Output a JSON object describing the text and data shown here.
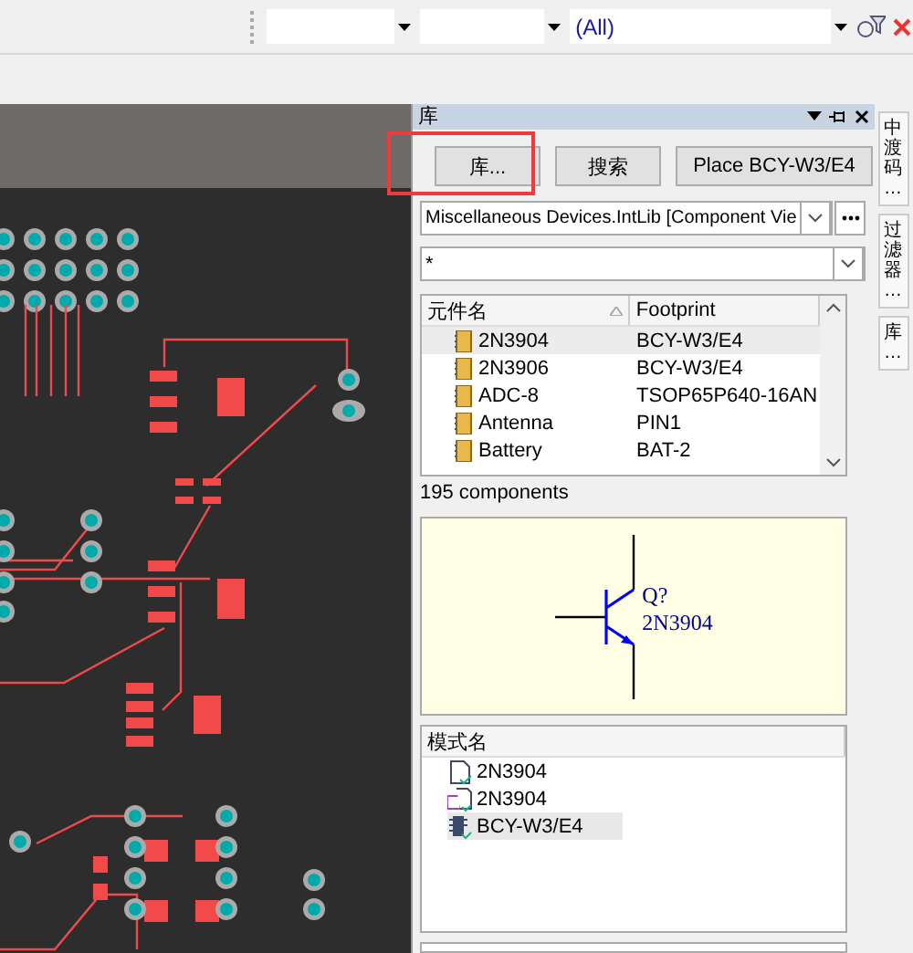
{
  "toolbar": {
    "filter_value": "(All)"
  },
  "library_panel": {
    "title": "库",
    "buttons": [
      {
        "label": "库..."
      },
      {
        "label": "搜索"
      },
      {
        "label": "Place BCY-W3/E4"
      }
    ],
    "library_select": "Miscellaneous Devices.IntLib [Component Vie",
    "filter": "*",
    "table": {
      "columns": [
        "元件名",
        "Footprint"
      ],
      "rows": [
        {
          "name": "2N3904",
          "footprint": "BCY-W3/E4",
          "selected": true
        },
        {
          "name": "2N3906",
          "footprint": "BCY-W3/E4",
          "selected": false
        },
        {
          "name": "ADC-8",
          "footprint": "TSOP65P640-16AN",
          "selected": false
        },
        {
          "name": "Antenna",
          "footprint": "PIN1",
          "selected": false
        },
        {
          "name": "Battery",
          "footprint": "BAT-2",
          "selected": false
        }
      ]
    },
    "count": "195 components",
    "preview": {
      "designator": "Q?",
      "comment": "2N3904"
    },
    "models": {
      "column": "模式名",
      "items": [
        {
          "kind": "simulation",
          "name": "2N3904",
          "selected": false
        },
        {
          "kind": "signal",
          "name": "2N3904",
          "selected": false
        },
        {
          "kind": "footprint",
          "name": "BCY-W3/E4",
          "selected": true
        }
      ]
    }
  },
  "side_tabs": [
    {
      "label": "中渡码…"
    },
    {
      "label": "过滤器…"
    },
    {
      "label": "库…"
    }
  ]
}
